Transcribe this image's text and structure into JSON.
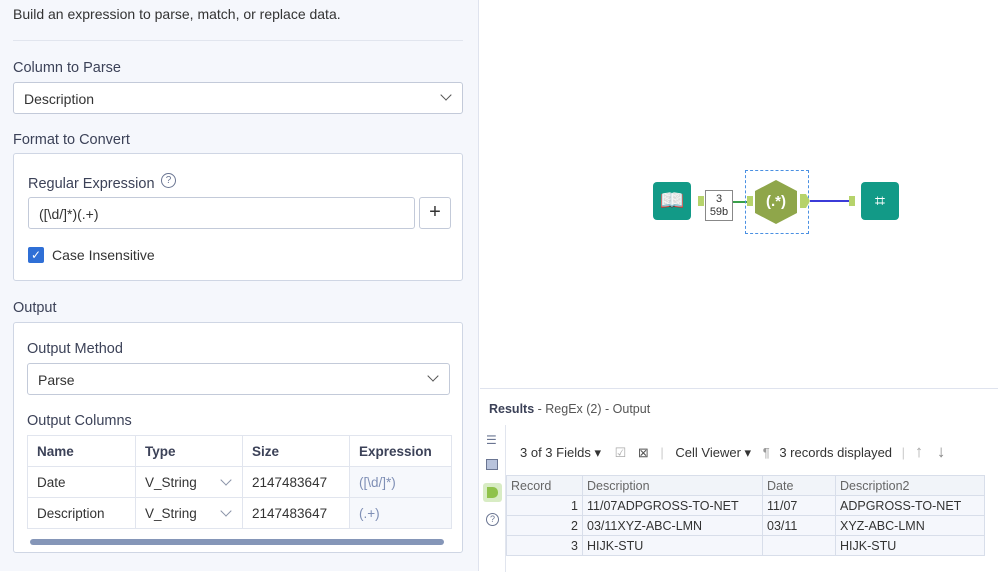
{
  "header": {
    "description": "Build an expression to parse, match, or replace data."
  },
  "column_to_parse": {
    "label": "Column to Parse",
    "value": "Description"
  },
  "format": {
    "label": "Format to Convert",
    "regex_label": "Regular Expression",
    "regex_value": "([\\d/]*)(.+)",
    "add": "+",
    "case_label": "Case Insensitive",
    "case_checked": true
  },
  "output": {
    "label": "Output",
    "method_label": "Output Method",
    "method_value": "Parse",
    "columns_label": "Output Columns",
    "headers": [
      "Name",
      "Type",
      "Size",
      "Expression"
    ],
    "rows": [
      [
        "Date",
        "V_String",
        "2147483647",
        "([\\d/]*)"
      ],
      [
        "Description",
        "V_String",
        "2147483647",
        "(.+)"
      ]
    ]
  },
  "workflow": {
    "badge_count": "3",
    "badge_size": "59b",
    "regex_tool": "(.*)"
  },
  "results": {
    "title": "Results",
    "subtitle": " - RegEx (2) - Output",
    "fields": "3 of 3 Fields",
    "cell_viewer": "Cell Viewer",
    "records": "3 records displayed",
    "headers": [
      "Record",
      "Description",
      "Date",
      "Description2"
    ],
    "rows": [
      [
        "1",
        "11/07ADPGROSS-TO-NET",
        "11/07",
        "ADPGROSS-TO-NET"
      ],
      [
        "2",
        "03/11XYZ-ABC-LMN",
        "03/11",
        "XYZ-ABC-LMN"
      ],
      [
        "3",
        "HIJK-STU",
        "",
        "HIJK-STU"
      ]
    ]
  }
}
